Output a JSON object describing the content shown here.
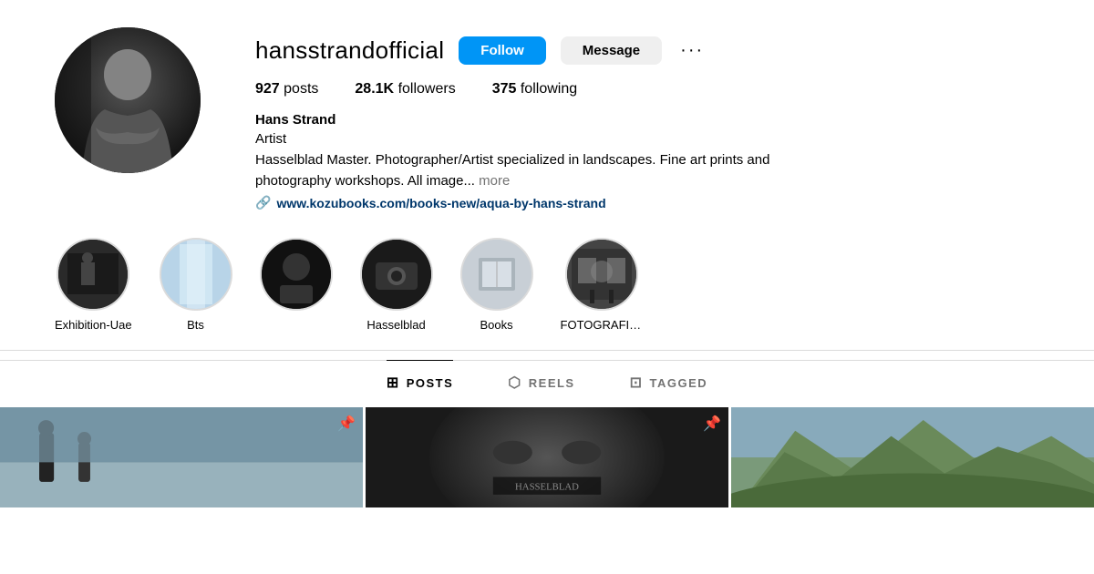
{
  "profile": {
    "username": "hansstrandofficial",
    "full_name": "Hans Strand",
    "occupation": "Artist",
    "bio": "Hasselblad Master. Photographer/Artist specialized in landscapes. Fine art prints and photography workshops. All image...",
    "bio_more": "more",
    "link": "www.kozubooks.com/books-new/aqua-by-hans-strand",
    "stats": {
      "posts": "927",
      "posts_label": "posts",
      "followers": "28.1K",
      "followers_label": "followers",
      "following": "375",
      "following_label": "following"
    },
    "buttons": {
      "follow": "Follow",
      "message": "Message",
      "more": "···"
    }
  },
  "highlights": [
    {
      "label": "Exhibition-Uae",
      "color": "hl-dark"
    },
    {
      "label": "Bts",
      "color": "hl-blue"
    },
    {
      "label": "",
      "color": "hl-black"
    },
    {
      "label": "Hasselblad",
      "color": "hl-darkgray"
    },
    {
      "label": "Books",
      "color": "hl-lightgray"
    },
    {
      "label": "FOTOGRAFIS...",
      "color": "hl-medgray"
    }
  ],
  "tabs": [
    {
      "label": "POSTS",
      "active": true,
      "icon": "⊞"
    },
    {
      "label": "REELS",
      "active": false,
      "icon": "▷"
    },
    {
      "label": "TAGGED",
      "active": false,
      "icon": "⊡"
    }
  ],
  "posts": [
    {
      "has_pin": true,
      "color": "post-bg-1"
    },
    {
      "has_pin": true,
      "color": "post-bg-2"
    },
    {
      "has_pin": false,
      "color": "post-bg-3"
    }
  ]
}
